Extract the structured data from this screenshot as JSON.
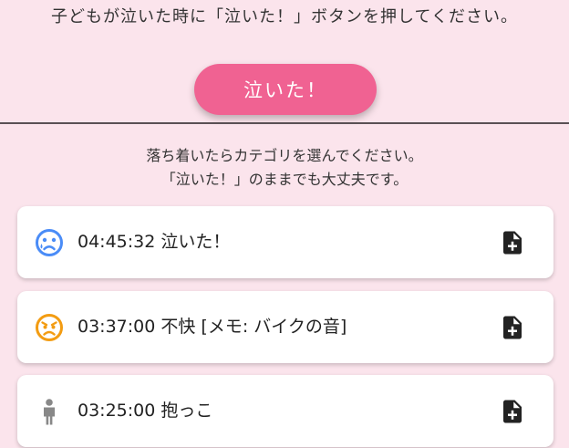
{
  "header": {
    "instruction": "子どもが泣いた時に「泣いた！」ボタンを押してください。",
    "cry_button_label": "泣いた！"
  },
  "note": {
    "line1": "落ち着いたらカテゴリを選んでください。",
    "line2": "「泣いた！」のままでも大丈夫です。"
  },
  "colors": {
    "background": "#fbe4ec",
    "accent": "#f06292",
    "crying_icon": "#4a8cf7",
    "discomfort_icon": "#f39c12",
    "holding_icon": "#888888"
  },
  "log_entries": [
    {
      "icon": "crying-face-icon",
      "text": "04:45:32 泣いた！"
    },
    {
      "icon": "angry-face-icon",
      "text": "03:37:00 不快 [メモ: バイクの音]"
    },
    {
      "icon": "person-icon",
      "text": "03:25:00 抱っこ"
    }
  ]
}
